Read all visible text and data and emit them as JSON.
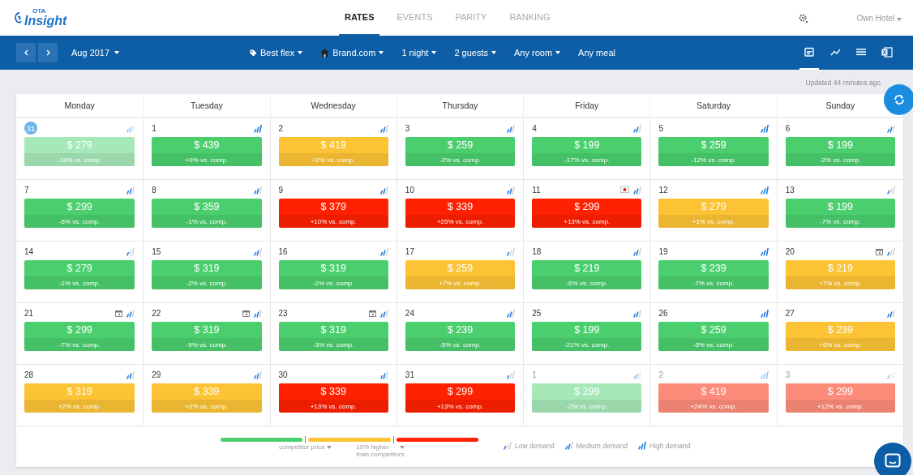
{
  "logo": {
    "small": "OTA",
    "name": "Insight"
  },
  "nav_tabs": [
    {
      "label": "RATES",
      "selected": true
    },
    {
      "label": "EVENTS",
      "selected": false
    },
    {
      "label": "PARITY",
      "selected": false
    },
    {
      "label": "RANKING",
      "selected": false
    }
  ],
  "hotel_menu": "Own Hotel",
  "toolbar": {
    "month": "Aug 2017",
    "filters": [
      "Best flex",
      "Brand.com",
      "1 night",
      "2 guests",
      "Any room"
    ],
    "meal": "Any meal",
    "views": [
      {
        "kind": "calendar",
        "selected": true
      },
      {
        "kind": "chart",
        "selected": false
      },
      {
        "kind": "list",
        "selected": false
      },
      {
        "kind": "excel",
        "selected": false
      }
    ]
  },
  "updated": "Updated 44 minutes ago",
  "weekdays": [
    "Monday",
    "Tuesday",
    "Wednesday",
    "Thursday",
    "Friday",
    "Saturday",
    "Sunday"
  ],
  "weeks": [
    [
      {
        "day": "31",
        "today": true,
        "other_month": true,
        "holiday": false,
        "event": false,
        "kind": "medium",
        "price": "$ 279",
        "diff": "-18% vs. comp.",
        "color": "#a6e8b8"
      },
      {
        "day": "1",
        "today": false,
        "other_month": false,
        "holiday": false,
        "event": false,
        "kind": "high",
        "price": "$ 439",
        "diff": "+0% vs. comp.",
        "color": "#4bcf6e"
      },
      {
        "day": "2",
        "today": false,
        "other_month": false,
        "holiday": false,
        "event": false,
        "kind": "medium",
        "price": "$ 419",
        "diff": "+2% vs. comp.",
        "color": "#fcc334"
      },
      {
        "day": "3",
        "today": false,
        "other_month": false,
        "holiday": false,
        "event": false,
        "kind": "medium",
        "price": "$ 259",
        "diff": "-2% vs. comp.",
        "color": "#4bcf6e"
      },
      {
        "day": "4",
        "today": false,
        "other_month": false,
        "holiday": false,
        "event": false,
        "kind": "medium",
        "price": "$ 199",
        "diff": "-17% vs. comp.",
        "color": "#4bcf6e"
      },
      {
        "day": "5",
        "today": false,
        "other_month": false,
        "holiday": false,
        "event": false,
        "kind": "high",
        "price": "$ 259",
        "diff": "-12% vs. comp.",
        "color": "#4bcf6e"
      },
      {
        "day": "6",
        "today": false,
        "other_month": false,
        "holiday": false,
        "event": false,
        "kind": "medium",
        "price": "$ 199",
        "diff": "-2% vs. comp.",
        "color": "#4bcf6e"
      }
    ],
    [
      {
        "day": "7",
        "today": false,
        "other_month": false,
        "holiday": false,
        "event": false,
        "kind": "medium",
        "price": "$ 299",
        "diff": "-6% vs. comp.",
        "color": "#4bcf6e"
      },
      {
        "day": "8",
        "today": false,
        "other_month": false,
        "holiday": false,
        "event": false,
        "kind": "medium",
        "price": "$ 359",
        "diff": "-1% vs. comp.",
        "color": "#4bcf6e"
      },
      {
        "day": "9",
        "today": false,
        "other_month": false,
        "holiday": false,
        "event": false,
        "kind": "medium",
        "price": "$ 379",
        "diff": "+10% vs. comp.",
        "color": "#ff2100"
      },
      {
        "day": "10",
        "today": false,
        "other_month": false,
        "holiday": false,
        "event": false,
        "kind": "medium",
        "price": "$ 339",
        "diff": "+25% vs. comp.",
        "color": "#ff2100"
      },
      {
        "day": "11",
        "today": false,
        "other_month": false,
        "holiday": true,
        "event": false,
        "kind": "medium",
        "price": "$ 299",
        "diff": "+13% vs. comp.",
        "color": "#ff2100"
      },
      {
        "day": "12",
        "today": false,
        "other_month": false,
        "holiday": false,
        "event": false,
        "kind": "high",
        "price": "$ 279",
        "diff": "+1% vs. comp.",
        "color": "#fcc334"
      },
      {
        "day": "13",
        "today": false,
        "other_month": false,
        "holiday": false,
        "event": false,
        "kind": "low",
        "price": "$ 199",
        "diff": "-7% vs. comp.",
        "color": "#4bcf6e"
      }
    ],
    [
      {
        "day": "14",
        "today": false,
        "other_month": false,
        "holiday": false,
        "event": false,
        "kind": "low",
        "price": "$ 279",
        "diff": "-1% vs. comp.",
        "color": "#4bcf6e"
      },
      {
        "day": "15",
        "today": false,
        "other_month": false,
        "holiday": false,
        "event": false,
        "kind": "medium",
        "price": "$ 319",
        "diff": "-2% vs. comp.",
        "color": "#4bcf6e"
      },
      {
        "day": "16",
        "today": false,
        "other_month": false,
        "holiday": false,
        "event": false,
        "kind": "medium",
        "price": "$ 319",
        "diff": "-2% vs. comp.",
        "color": "#4bcf6e"
      },
      {
        "day": "17",
        "today": false,
        "other_month": false,
        "holiday": false,
        "event": false,
        "kind": "low",
        "price": "$ 259",
        "diff": "+7% vs. comp.",
        "color": "#fcc334"
      },
      {
        "day": "18",
        "today": false,
        "other_month": false,
        "holiday": false,
        "event": false,
        "kind": "medium",
        "price": "$ 219",
        "diff": "-6% vs. comp.",
        "color": "#4bcf6e"
      },
      {
        "day": "19",
        "today": false,
        "other_month": false,
        "holiday": false,
        "event": false,
        "kind": "high",
        "price": "$ 239",
        "diff": "-7% vs. comp.",
        "color": "#4bcf6e"
      },
      {
        "day": "20",
        "today": false,
        "other_month": false,
        "holiday": false,
        "event": true,
        "kind": "low",
        "price": "$ 219",
        "diff": "+7% vs. comp.",
        "color": "#fcc334"
      }
    ],
    [
      {
        "day": "21",
        "today": false,
        "other_month": false,
        "holiday": false,
        "event": true,
        "kind": "medium",
        "price": "$ 299",
        "diff": "-7% vs. comp.",
        "color": "#4bcf6e"
      },
      {
        "day": "22",
        "today": false,
        "other_month": false,
        "holiday": false,
        "event": true,
        "kind": "medium",
        "price": "$ 319",
        "diff": "-9% vs. comp.",
        "color": "#4bcf6e"
      },
      {
        "day": "23",
        "today": false,
        "other_month": false,
        "holiday": false,
        "event": true,
        "kind": "medium",
        "price": "$ 319",
        "diff": "-3% vs. comp.",
        "color": "#4bcf6e"
      },
      {
        "day": "24",
        "today": false,
        "other_month": false,
        "holiday": false,
        "event": false,
        "kind": "medium",
        "price": "$ 239",
        "diff": "-5% vs. comp.",
        "color": "#4bcf6e"
      },
      {
        "day": "25",
        "today": false,
        "other_month": false,
        "holiday": false,
        "event": false,
        "kind": "medium",
        "price": "$ 199",
        "diff": "-21% vs. comp.",
        "color": "#4bcf6e"
      },
      {
        "day": "26",
        "today": false,
        "other_month": false,
        "holiday": false,
        "event": false,
        "kind": "high",
        "price": "$ 259",
        "diff": "-5% vs. comp.",
        "color": "#4bcf6e"
      },
      {
        "day": "27",
        "today": false,
        "other_month": false,
        "holiday": false,
        "event": false,
        "kind": "medium",
        "price": "$ 239",
        "diff": "+6% vs. comp.",
        "color": "#fcc334"
      }
    ],
    [
      {
        "day": "28",
        "today": false,
        "other_month": false,
        "holiday": false,
        "event": false,
        "kind": "medium",
        "price": "$ 319",
        "diff": "+2% vs. comp.",
        "color": "#fcc334"
      },
      {
        "day": "29",
        "today": false,
        "other_month": false,
        "holiday": false,
        "event": false,
        "kind": "medium",
        "price": "$ 339",
        "diff": "+2% vs. comp.",
        "color": "#fcc334"
      },
      {
        "day": "30",
        "today": false,
        "other_month": false,
        "holiday": false,
        "event": false,
        "kind": "medium",
        "price": "$ 339",
        "diff": "+13% vs. comp.",
        "color": "#ff2100"
      },
      {
        "day": "31",
        "today": false,
        "other_month": false,
        "holiday": false,
        "event": false,
        "kind": "low",
        "price": "$ 299",
        "diff": "+13% vs. comp.",
        "color": "#ff2100"
      },
      {
        "day": "1",
        "today": false,
        "other_month": true,
        "holiday": false,
        "event": false,
        "kind": "medium",
        "price": "$ 299",
        "diff": "-2% vs. comp.",
        "color": "#a6e8b8"
      },
      {
        "day": "2",
        "today": false,
        "other_month": true,
        "holiday": false,
        "event": false,
        "kind": "high",
        "price": "$ 419",
        "diff": "+24% vs. comp.",
        "color": "#fd8b7a"
      },
      {
        "day": "3",
        "today": false,
        "other_month": true,
        "holiday": false,
        "event": false,
        "kind": "low",
        "price": "$ 299",
        "diff": "+12% vs. comp.",
        "color": "#fd8b7a"
      }
    ]
  ],
  "legend": {
    "threshold_low": "competitor price",
    "threshold_high_1": "10% higher",
    "threshold_high_2": "than competitors",
    "demand": [
      {
        "kind": "low",
        "label": "Low demand"
      },
      {
        "kind": "medium",
        "label": "Medium demand"
      },
      {
        "kind": "high",
        "label": "High demand"
      }
    ]
  }
}
